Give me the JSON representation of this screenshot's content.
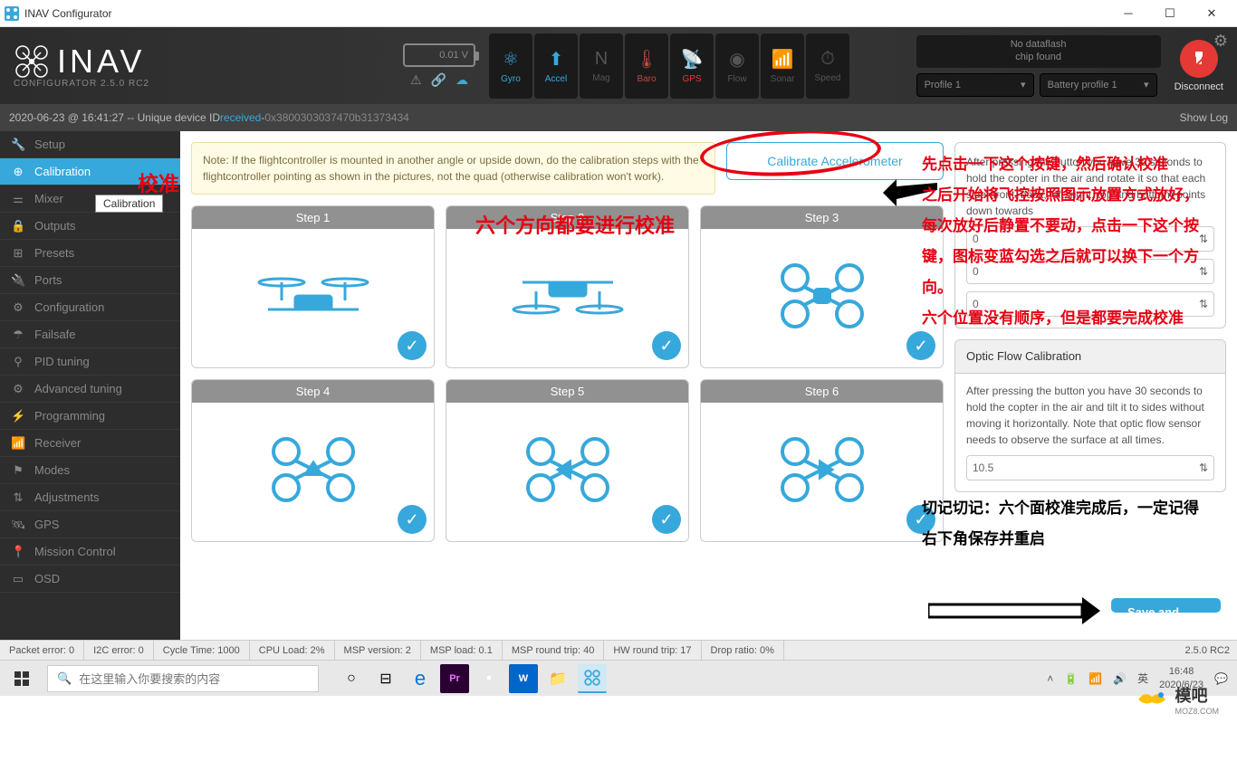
{
  "window": {
    "title": "INAV Configurator"
  },
  "header": {
    "logo_text": "INAV",
    "logo_sub": "CONFIGURATOR    2.5.0 RC2",
    "battery_voltage": "0.01 V",
    "sensors": [
      {
        "label": "Gyro",
        "state": "active"
      },
      {
        "label": "Accel",
        "state": "active"
      },
      {
        "label": "Mag",
        "state": "inactive"
      },
      {
        "label": "Baro",
        "state": "baro"
      },
      {
        "label": "GPS",
        "state": "gps"
      },
      {
        "label": "Flow",
        "state": "inactive"
      },
      {
        "label": "Sonar",
        "state": "inactive"
      },
      {
        "label": "Speed",
        "state": "inactive"
      }
    ],
    "dataflash_line1": "No dataflash",
    "dataflash_line2": "chip found",
    "profile_label": "Profile 1",
    "battery_profile_label": "Battery profile 1",
    "disconnect_label": "Disconnect"
  },
  "statusbar": {
    "timestamp": "2020-06-23 @ 16:41:27 -- Unique device ID ",
    "received": "received",
    "dash": " - ",
    "device_id": "0x3800303037470b31373434",
    "show_log": "Show Log"
  },
  "sidebar": {
    "items": [
      {
        "icon": "wrench",
        "label": "Setup"
      },
      {
        "icon": "target",
        "label": "Calibration"
      },
      {
        "icon": "sliders",
        "label": "Mixer"
      },
      {
        "icon": "lock",
        "label": "Outputs"
      },
      {
        "icon": "grid",
        "label": "Presets"
      },
      {
        "icon": "plug",
        "label": "Ports"
      },
      {
        "icon": "gear",
        "label": "Configuration"
      },
      {
        "icon": "parachute",
        "label": "Failsafe"
      },
      {
        "icon": "tune",
        "label": "PID tuning"
      },
      {
        "icon": "tune2",
        "label": "Advanced tuning"
      },
      {
        "icon": "code",
        "label": "Programming"
      },
      {
        "icon": "signal",
        "label": "Receiver"
      },
      {
        "icon": "flag",
        "label": "Modes"
      },
      {
        "icon": "adjust",
        "label": "Adjustments"
      },
      {
        "icon": "sat",
        "label": "GPS"
      },
      {
        "icon": "pin",
        "label": "Mission Control"
      },
      {
        "icon": "display",
        "label": "OSD"
      }
    ],
    "tooltip": "Calibration"
  },
  "content": {
    "note": "Note: If the flightcontroller is mounted in another angle or upside down, do the calibration steps with the flightcontroller pointing as shown in the pictures, not the quad (otherwise calibration won't work).",
    "calibrate_btn": "Calibrate Accelerometer",
    "steps": [
      "Step 1",
      "Step 2",
      "Step 3",
      "Step 4",
      "Step 5",
      "Step 6"
    ],
    "accel_text": "After pressing the button you have 30 seconds to hold the copter in the air and rotate it so that each side (front, back, left, right, top and bottom) points down towards",
    "accel_inputs": [
      "0",
      "0",
      "0"
    ],
    "optic_title": "Optic Flow Calibration",
    "optic_text": "After pressing the button you have 30 seconds to hold the copter in the air and tilt it to sides without moving it horizontally. Note that optic flow sensor needs to observe the surface at all times.",
    "optic_input": "10.5",
    "save_btn": "Save and Reboot"
  },
  "annotations": {
    "side": "校准",
    "six_sides": "六个方向都要进行校准",
    "main_red": "先点击一下这个按键，然后确认校准\n之后开始将飞控按照图示放置方式放好，每次放好后静置不要动，点击一下这个按键，图标变蓝勾选之后就可以换下一个方向。\n六个位置没有顺序，但是都要完成校准",
    "save_red": "切记切记：六个面校准完成后，一定记得右下角保存并重启"
  },
  "footer": {
    "stats": [
      "Packet error: 0",
      "I2C error: 0",
      "Cycle Time: 1000",
      "CPU Load: 2%",
      "MSP version: 2",
      "MSP load: 0.1",
      "MSP round trip: 40",
      "HW round trip: 17",
      "Drop ratio: 0%"
    ],
    "version": "2.5.0 RC2"
  },
  "taskbar": {
    "search_placeholder": "在这里输入你要搜索的内容",
    "lang": "英",
    "time": "16:48",
    "date": "2020/6/23"
  },
  "watermark": {
    "text": "模吧",
    "sub": "MOZ8.COM"
  }
}
